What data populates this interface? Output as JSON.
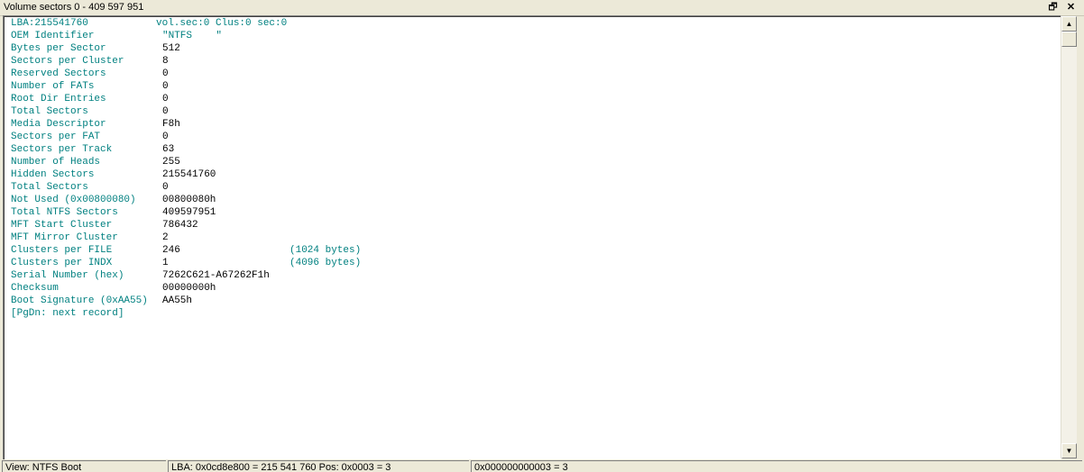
{
  "window": {
    "title": "Volume sectors 0 - 409 597 951",
    "restore_glyph": "🗗",
    "close_glyph": "✕"
  },
  "header": {
    "lba": "LBA:215541760",
    "volsec": "vol.sec:0 Clus:0 sec:0"
  },
  "fields": [
    {
      "label": "OEM Identifier",
      "value": "\"NTFS    \"",
      "extra": ""
    },
    {
      "label": "Bytes per Sector",
      "value": "512",
      "extra": ""
    },
    {
      "label": "Sectors per Cluster",
      "value": "8",
      "extra": ""
    },
    {
      "label": "Reserved Sectors",
      "value": "0",
      "extra": ""
    },
    {
      "label": "Number of FATs",
      "value": "0",
      "extra": ""
    },
    {
      "label": "Root Dir Entries",
      "value": "0",
      "extra": ""
    },
    {
      "label": "Total Sectors",
      "value": "0",
      "extra": ""
    },
    {
      "label": "Media Descriptor",
      "value": "F8h",
      "extra": ""
    },
    {
      "label": "Sectors per FAT",
      "value": "0",
      "extra": ""
    },
    {
      "label": "Sectors per Track",
      "value": "63",
      "extra": ""
    },
    {
      "label": "Number of Heads",
      "value": "255",
      "extra": ""
    },
    {
      "label": "Hidden Sectors",
      "value": "215541760",
      "extra": ""
    },
    {
      "label": "Total Sectors",
      "value": "0",
      "extra": ""
    },
    {
      "label": "Not Used (0x00800080)",
      "value": "00800080h",
      "extra": ""
    },
    {
      "label": "Total NTFS Sectors",
      "value": "409597951",
      "extra": ""
    },
    {
      "label": "MFT Start Cluster",
      "value": "786432",
      "extra": ""
    },
    {
      "label": "MFT Mirror Cluster",
      "value": "2",
      "extra": ""
    },
    {
      "label": "Clusters per FILE",
      "value": "246",
      "extra": "(1024 bytes)"
    },
    {
      "label": "Clusters per INDX",
      "value": "1",
      "extra": "(4096 bytes)"
    },
    {
      "label": "Serial Number (hex)",
      "value": "7262C621-A67262F1h",
      "extra": ""
    },
    {
      "label": "Checksum",
      "value": "00000000h",
      "extra": ""
    },
    {
      "label": "Boot Signature (0xAA55)",
      "value": "AA55h",
      "extra": ""
    }
  ],
  "footer_link": "[PgDn: next record]",
  "scrollbar": {
    "up_glyph": "▲",
    "down_glyph": "▼"
  },
  "status": {
    "view": "View: NTFS Boot",
    "lba_pos": "LBA: 0x0cd8e800 = 215 541 760  Pos: 0x0003 = 3",
    "offset": "0x000000000003 = 3"
  }
}
